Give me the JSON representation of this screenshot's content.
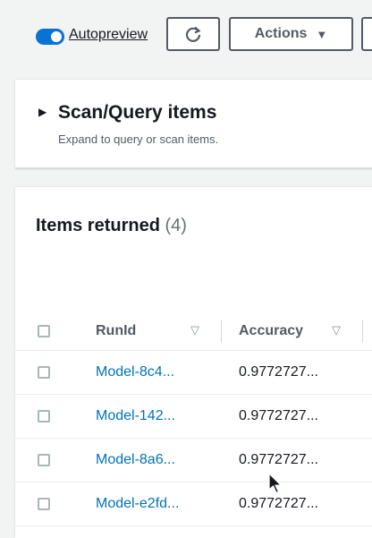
{
  "toolbar": {
    "autopreview_label": "Autopreview",
    "refresh_icon": "refresh-icon",
    "actions_label": "Actions",
    "actions_caret": "▼"
  },
  "scan_panel": {
    "title": "Scan/Query items",
    "description": "Expand to query or scan items.",
    "expand_icon": "▶"
  },
  "items": {
    "heading": "Items returned",
    "count": "(4)",
    "columns": [
      {
        "label": "RunId",
        "sort_icon": "▽"
      },
      {
        "label": "Accuracy",
        "sort_icon": "▽"
      }
    ],
    "rows": [
      {
        "runid": "Model-8c4...",
        "accuracy": "0.9772727..."
      },
      {
        "runid": "Model-142...",
        "accuracy": "0.9772727..."
      },
      {
        "runid": "Model-8a6...",
        "accuracy": "0.9772727..."
      },
      {
        "runid": "Model-e2fd...",
        "accuracy": "0.9772727..."
      }
    ]
  },
  "colors": {
    "accent": "#0972d3",
    "link": "#0073bb",
    "background": "#f2f3f3"
  }
}
